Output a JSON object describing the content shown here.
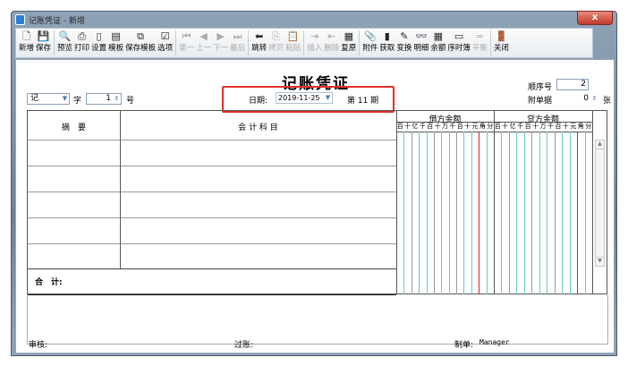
{
  "window": {
    "title": "记账凭证 - 新增",
    "close": "x"
  },
  "toolbar": [
    {
      "icon": "new-icon",
      "glyph": "🗋",
      "label": "新增",
      "enabled": true
    },
    {
      "icon": "save-icon",
      "glyph": "💾",
      "label": "保存",
      "enabled": true,
      "sep_after": true
    },
    {
      "icon": "preview-icon",
      "glyph": "🔍",
      "label": "预览",
      "enabled": true
    },
    {
      "icon": "print-icon",
      "glyph": "⎙",
      "label": "打印",
      "enabled": true
    },
    {
      "icon": "settings-icon",
      "glyph": "▯",
      "label": "设置",
      "enabled": true
    },
    {
      "icon": "template-icon",
      "glyph": "▤",
      "label": "模板",
      "enabled": true
    },
    {
      "icon": "save-template-icon",
      "glyph": "⧉",
      "label": "保存模板",
      "enabled": true
    },
    {
      "icon": "options-icon",
      "glyph": "☑",
      "label": "选项",
      "enabled": true,
      "sep_after": true
    },
    {
      "icon": "first-icon",
      "glyph": "⏮",
      "label": "第一",
      "enabled": false
    },
    {
      "icon": "prev-icon",
      "glyph": "◀",
      "label": "上一",
      "enabled": false
    },
    {
      "icon": "next-icon",
      "glyph": "▶",
      "label": "下一",
      "enabled": false
    },
    {
      "icon": "last-icon",
      "glyph": "⏭",
      "label": "最后",
      "enabled": false,
      "sep_after": true
    },
    {
      "icon": "jump-icon",
      "glyph": "⬅",
      "label": "跳转",
      "enabled": true
    },
    {
      "icon": "copy-icon",
      "glyph": "⎘",
      "label": "拷贝",
      "enabled": false
    },
    {
      "icon": "paste-icon",
      "glyph": "📋",
      "label": "粘贴",
      "enabled": false,
      "sep_after": true
    },
    {
      "icon": "insert-icon",
      "glyph": "⇥",
      "label": "插入",
      "enabled": false
    },
    {
      "icon": "delete-icon",
      "glyph": "⇤",
      "label": "删除",
      "enabled": false
    },
    {
      "icon": "restore-icon",
      "glyph": "▦",
      "label": "复原",
      "enabled": true,
      "sep_after": true
    },
    {
      "icon": "attachment-icon",
      "glyph": "📎",
      "label": "附件",
      "enabled": true
    },
    {
      "icon": "fetch-icon",
      "glyph": "▮",
      "label": "获取",
      "enabled": true
    },
    {
      "icon": "transform-icon",
      "glyph": "✎",
      "label": "变换",
      "enabled": true
    },
    {
      "icon": "detail-icon",
      "glyph": "👓",
      "label": "明细",
      "enabled": true
    },
    {
      "icon": "balance-icon",
      "glyph": "▦",
      "label": "余额",
      "enabled": true
    },
    {
      "icon": "journal-icon",
      "glyph": "▭",
      "label": "序时簿",
      "enabled": true
    },
    {
      "icon": "equal-icon",
      "glyph": "=",
      "label": "平衡",
      "enabled": false,
      "sep_after": true
    },
    {
      "icon": "close-door-icon",
      "glyph": "🚪",
      "label": "关闭",
      "enabled": true
    }
  ],
  "voucher": {
    "title": "记账凭证",
    "word": "记",
    "word_label": "字",
    "number": "1",
    "number_label": "号",
    "date_label": "日期:",
    "date": "2019-11-25",
    "period": "第 11 期",
    "seq_label": "顺序号",
    "seq": "2",
    "attach_label": "附单据",
    "attach": "0",
    "attach_unit": "张"
  },
  "table": {
    "col_summary": "摘　要",
    "col_account": "会 计 科 目",
    "col_debit": "借方金额",
    "col_credit": "贷方金额",
    "digits": [
      "千",
      "百",
      "十",
      "亿",
      "千",
      "百",
      "十",
      "万",
      "千",
      "百",
      "十",
      "元",
      "角",
      "分"
    ],
    "total_label": "合　计:"
  },
  "footer": {
    "audit": "审核:",
    "post": "过账:",
    "maker_label": "制单:",
    "maker": "Manager"
  }
}
